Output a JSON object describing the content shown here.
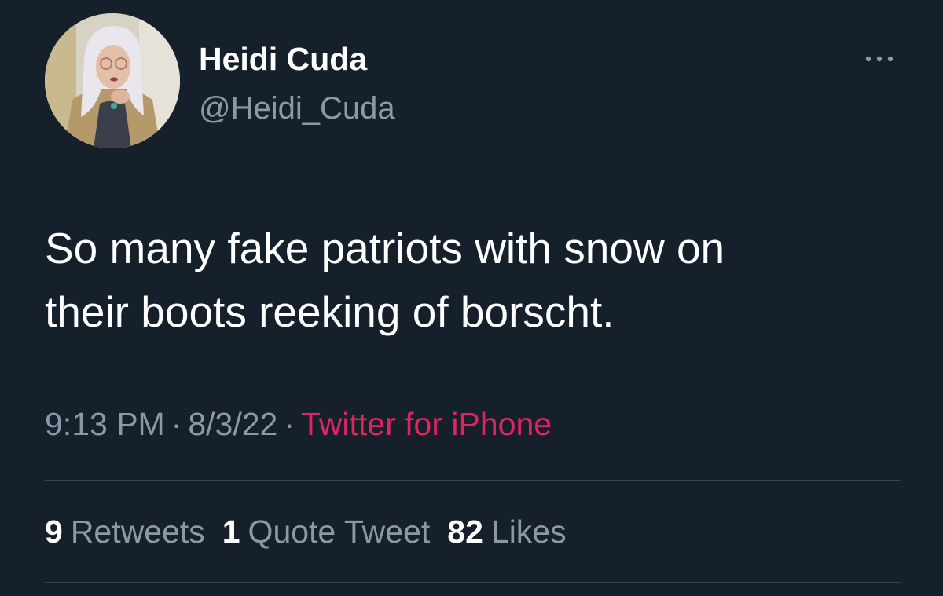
{
  "tweet": {
    "author": {
      "display_name": "Heidi Cuda",
      "handle": "@Heidi_Cuda"
    },
    "text_line1": "So many fake patriots with snow on",
    "text_line2": "their boots reeking of borscht.",
    "time": "9:13 PM",
    "date": "8/3/22",
    "separator": "·",
    "source": "Twitter for iPhone"
  },
  "stats": {
    "retweets_count": "9",
    "retweets_label": "Retweets",
    "quotes_count": "1",
    "quotes_label": "Quote Tweet",
    "likes_count": "82",
    "likes_label": "Likes"
  },
  "icons": {
    "more": "more-horizontal-icon"
  },
  "colors": {
    "background": "#15202b",
    "secondary_text": "#8b98a5",
    "source_link": "#e0245e",
    "divider": "#38444d"
  }
}
